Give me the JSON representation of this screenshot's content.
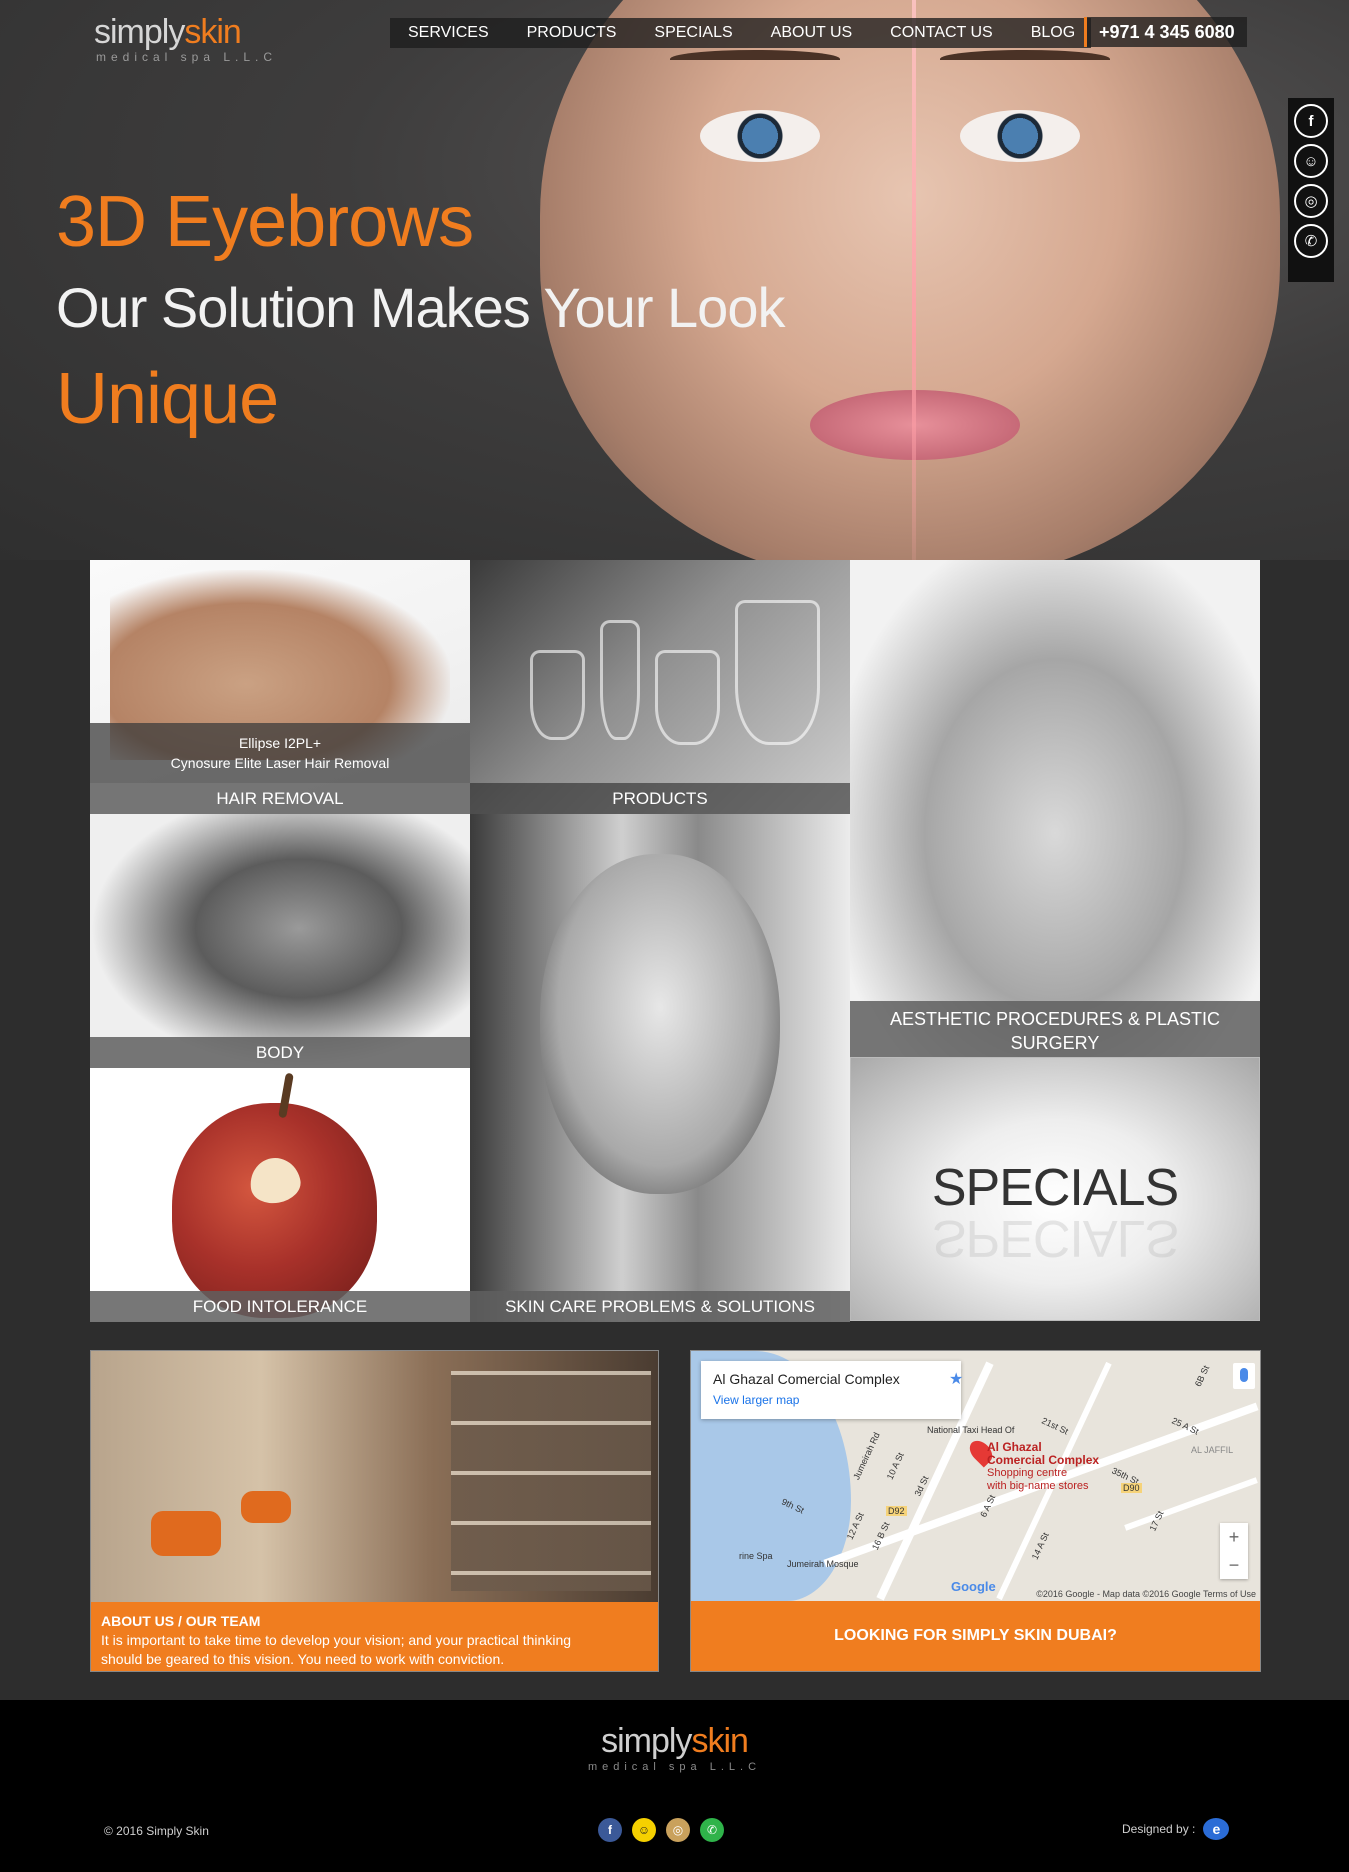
{
  "brand": {
    "name_part1": "simply",
    "name_part2": "skin",
    "tagline": "medical spa L.L.C",
    "accent": "#f07d1f"
  },
  "nav": {
    "items": [
      "SERVICES",
      "PRODUCTS",
      "SPECIALS",
      "ABOUT US",
      "CONTACT US",
      "BLOG"
    ],
    "phone": "+971 4 345 6080"
  },
  "social": {
    "icons": [
      "facebook-icon",
      "snapchat-icon",
      "instagram-icon",
      "whatsapp-icon"
    ],
    "glyphs": [
      "f",
      "☺",
      "◎",
      "✆"
    ]
  },
  "hero": {
    "line1": "3D Eyebrows",
    "line2": "Our Solution Makes Your Look",
    "line3": "Unique"
  },
  "tiles": {
    "hair_removal": {
      "subtitle_1": "Ellipse I2PL+",
      "subtitle_2": "Cynosure Elite Laser Hair Removal",
      "label": "HAIR REMOVAL"
    },
    "products": {
      "label": "PRODUCTS"
    },
    "aesthetic": {
      "label_1": "AESTHETIC PROCEDURES & PLASTIC",
      "label_2": "SURGERY"
    },
    "body": {
      "label": "BODY"
    },
    "skin_care": {
      "label": "SKIN CARE PROBLEMS & SOLUTIONS"
    },
    "food": {
      "label": "FOOD INTOLERANCE"
    },
    "specials": {
      "label": "SPECIALS"
    }
  },
  "about": {
    "title": "ABOUT US / OUR TEAM",
    "text_1": "It is important to take time to develop your vision; and your practical thinking",
    "text_2": "should be geared to this vision. You need to work with conviction."
  },
  "map": {
    "place_name": "Al Ghazal Comercial Complex",
    "view_larger": "View larger map",
    "pin_title_1": "Al Ghazal",
    "pin_title_2": "Comercial Complex",
    "pin_sub_1": "Shopping centre",
    "pin_sub_2": "with big-name stores",
    "poi": "National Taxi Head Of",
    "mosque": "Jumeirah Mosque",
    "spa": "rine Spa",
    "district": "AL JAFFIL",
    "street_labels": [
      "Jumeirah Rd",
      "10 A St",
      "3d St",
      "9th St",
      "12 A St",
      "16 B St",
      "21st St",
      "25 A St",
      "35th St",
      "6 A St",
      "14 A St",
      "17 St",
      "6B St",
      "D90",
      "D92"
    ],
    "google": "Google",
    "attribution": "©2016 Google - Map data ©2016 Google   Terms of Use",
    "zoom_in": "+",
    "zoom_out": "−",
    "cta": "LOOKING FOR SIMPLY SKIN DUBAI?"
  },
  "footer": {
    "copyright": "© 2016 Simply Skin",
    "designed_by": "Designed by :",
    "designer_glyph": "e",
    "social_glyphs": [
      "f",
      "☺",
      "◎",
      "✆"
    ],
    "social_colors": [
      "#3b5998",
      "#f5d000",
      "#c9a15c",
      "#2fb34a"
    ]
  }
}
